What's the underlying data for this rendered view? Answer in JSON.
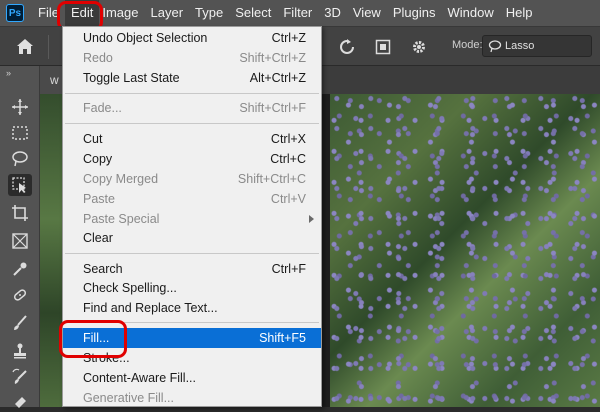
{
  "app": {
    "logo_text": "Ps"
  },
  "menubar": {
    "items": [
      "File",
      "Edit",
      "Image",
      "Layer",
      "Type",
      "Select",
      "Filter",
      "3D",
      "View",
      "Plugins",
      "Window",
      "Help"
    ]
  },
  "options": {
    "mode_label": "Mode:",
    "mode_value": "Lasso"
  },
  "document": {
    "tab_label": "w"
  },
  "edit_menu": {
    "items": [
      {
        "label": "Undo Object Selection",
        "shortcut": "Ctrl+Z",
        "disabled": false
      },
      {
        "label": "Redo",
        "shortcut": "Shift+Ctrl+Z",
        "disabled": true
      },
      {
        "label": "Toggle Last State",
        "shortcut": "Alt+Ctrl+Z",
        "disabled": false
      },
      {
        "label": "Fade...",
        "shortcut": "Shift+Ctrl+F",
        "disabled": true
      },
      {
        "label": "Cut",
        "shortcut": "Ctrl+X",
        "disabled": false
      },
      {
        "label": "Copy",
        "shortcut": "Ctrl+C",
        "disabled": false
      },
      {
        "label": "Copy Merged",
        "shortcut": "Shift+Ctrl+C",
        "disabled": true
      },
      {
        "label": "Paste",
        "shortcut": "Ctrl+V",
        "disabled": true
      },
      {
        "label": "Paste Special",
        "shortcut": "",
        "disabled": true,
        "submenu": true
      },
      {
        "label": "Clear",
        "shortcut": "",
        "disabled": false
      },
      {
        "label": "Search",
        "shortcut": "Ctrl+F",
        "disabled": false
      },
      {
        "label": "Check Spelling...",
        "shortcut": "",
        "disabled": false
      },
      {
        "label": "Find and Replace Text...",
        "shortcut": "",
        "disabled": false
      },
      {
        "label": "Fill...",
        "shortcut": "Shift+F5",
        "disabled": false,
        "highlighted": true
      },
      {
        "label": "Stroke...",
        "shortcut": "",
        "disabled": false
      },
      {
        "label": "Content-Aware Fill...",
        "shortcut": "",
        "disabled": false
      },
      {
        "label": "Generative Fill...",
        "shortcut": "",
        "disabled": true
      }
    ]
  },
  "colors": {
    "annotation_ring": "#e00000",
    "menu_highlight": "#0a6fd6",
    "menubar_bg": "#535353"
  }
}
